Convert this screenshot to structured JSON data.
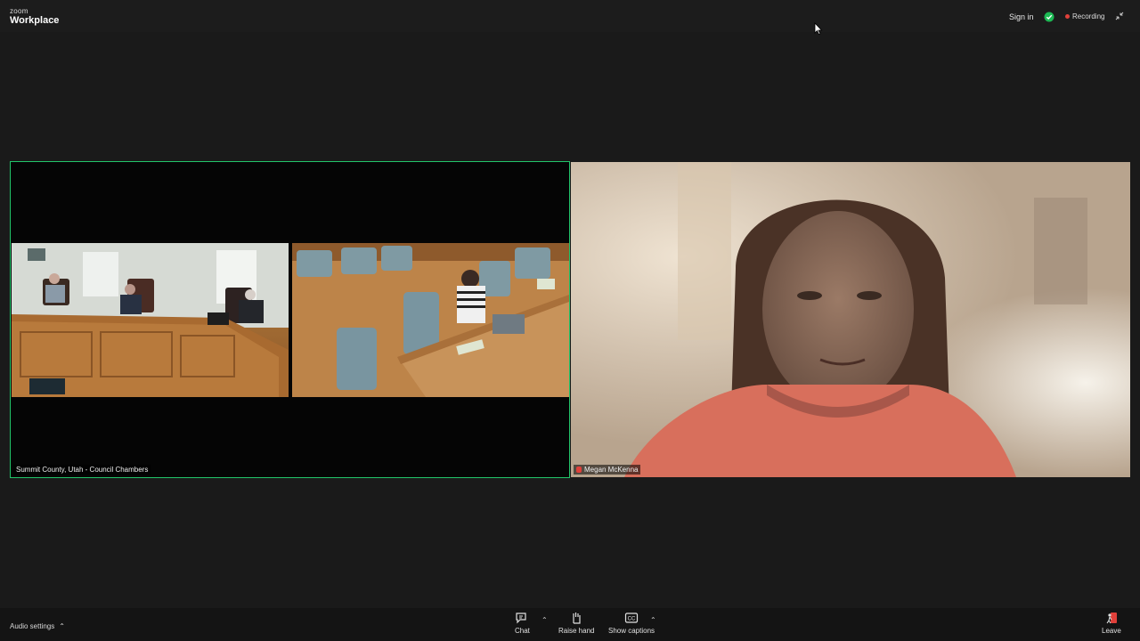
{
  "app": {
    "brand_small": "zoom",
    "brand_name": "Workplace"
  },
  "header": {
    "sign_in": "Sign in",
    "recording": "Recording"
  },
  "participants": [
    {
      "name": "Summit County, Utah - Council Chambers"
    },
    {
      "name": "Megan McKenna"
    }
  ],
  "toolbar": {
    "audio_settings": "Audio settings",
    "chat": "Chat",
    "raise_hand": "Raise hand",
    "show_captions": "Show captions",
    "leave": "Leave"
  },
  "colors": {
    "active_speaker_border": "#22c56a",
    "recording_dot": "#e0403a",
    "shield": "#1db954",
    "leave_red": "#e0403a"
  },
  "icons": [
    "shield-check-icon",
    "exit-fullscreen-icon",
    "chat-icon",
    "raise-hand-icon",
    "captions-icon",
    "leave-icon",
    "chevron-up-icon"
  ]
}
